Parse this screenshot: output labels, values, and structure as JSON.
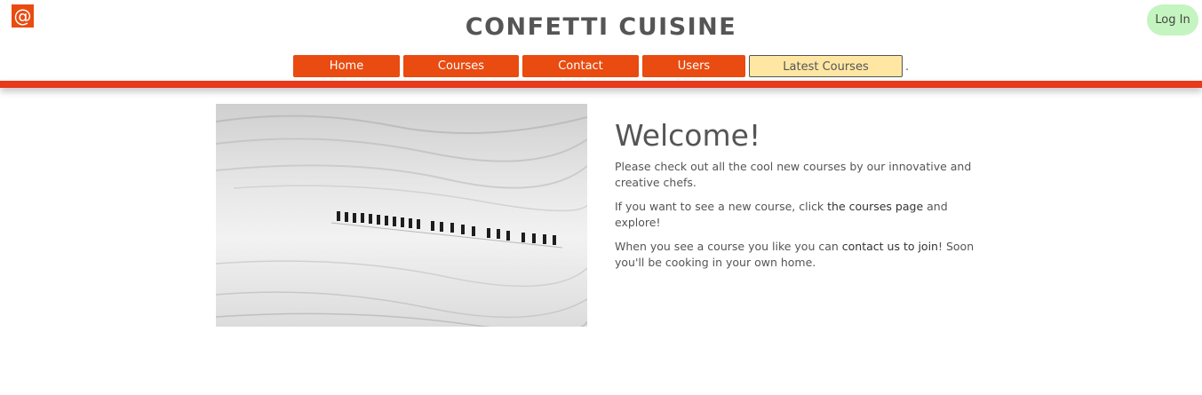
{
  "header": {
    "logo_glyph": "@",
    "site_title": "CONFETTI CUISINE",
    "login_label": "Log In"
  },
  "nav": {
    "items": [
      {
        "label": "Home"
      },
      {
        "label": "Courses"
      },
      {
        "label": "Contact"
      },
      {
        "label": "Users"
      },
      {
        "label": "Latest Courses"
      }
    ],
    "trailing_dot": "."
  },
  "main": {
    "heading": "Welcome!",
    "paragraph1": "Please check out all the cool new courses by our innovative and creative chefs.",
    "paragraph2": {
      "before": "If you want to see a new course, click ",
      "link": "the courses page",
      "after": " and explore!"
    },
    "paragraph3": {
      "before": "When you see a course you like you can ",
      "link": "contact us to join",
      "after": "! Soon you'll be cooking in your own home."
    }
  },
  "colors": {
    "accent": "#e94b10",
    "highlight_nav": "#ffe7a3",
    "login_bg": "#c4f5c0",
    "rule": "#e8391a"
  },
  "icons": {
    "logo": "at-sign-icon"
  }
}
